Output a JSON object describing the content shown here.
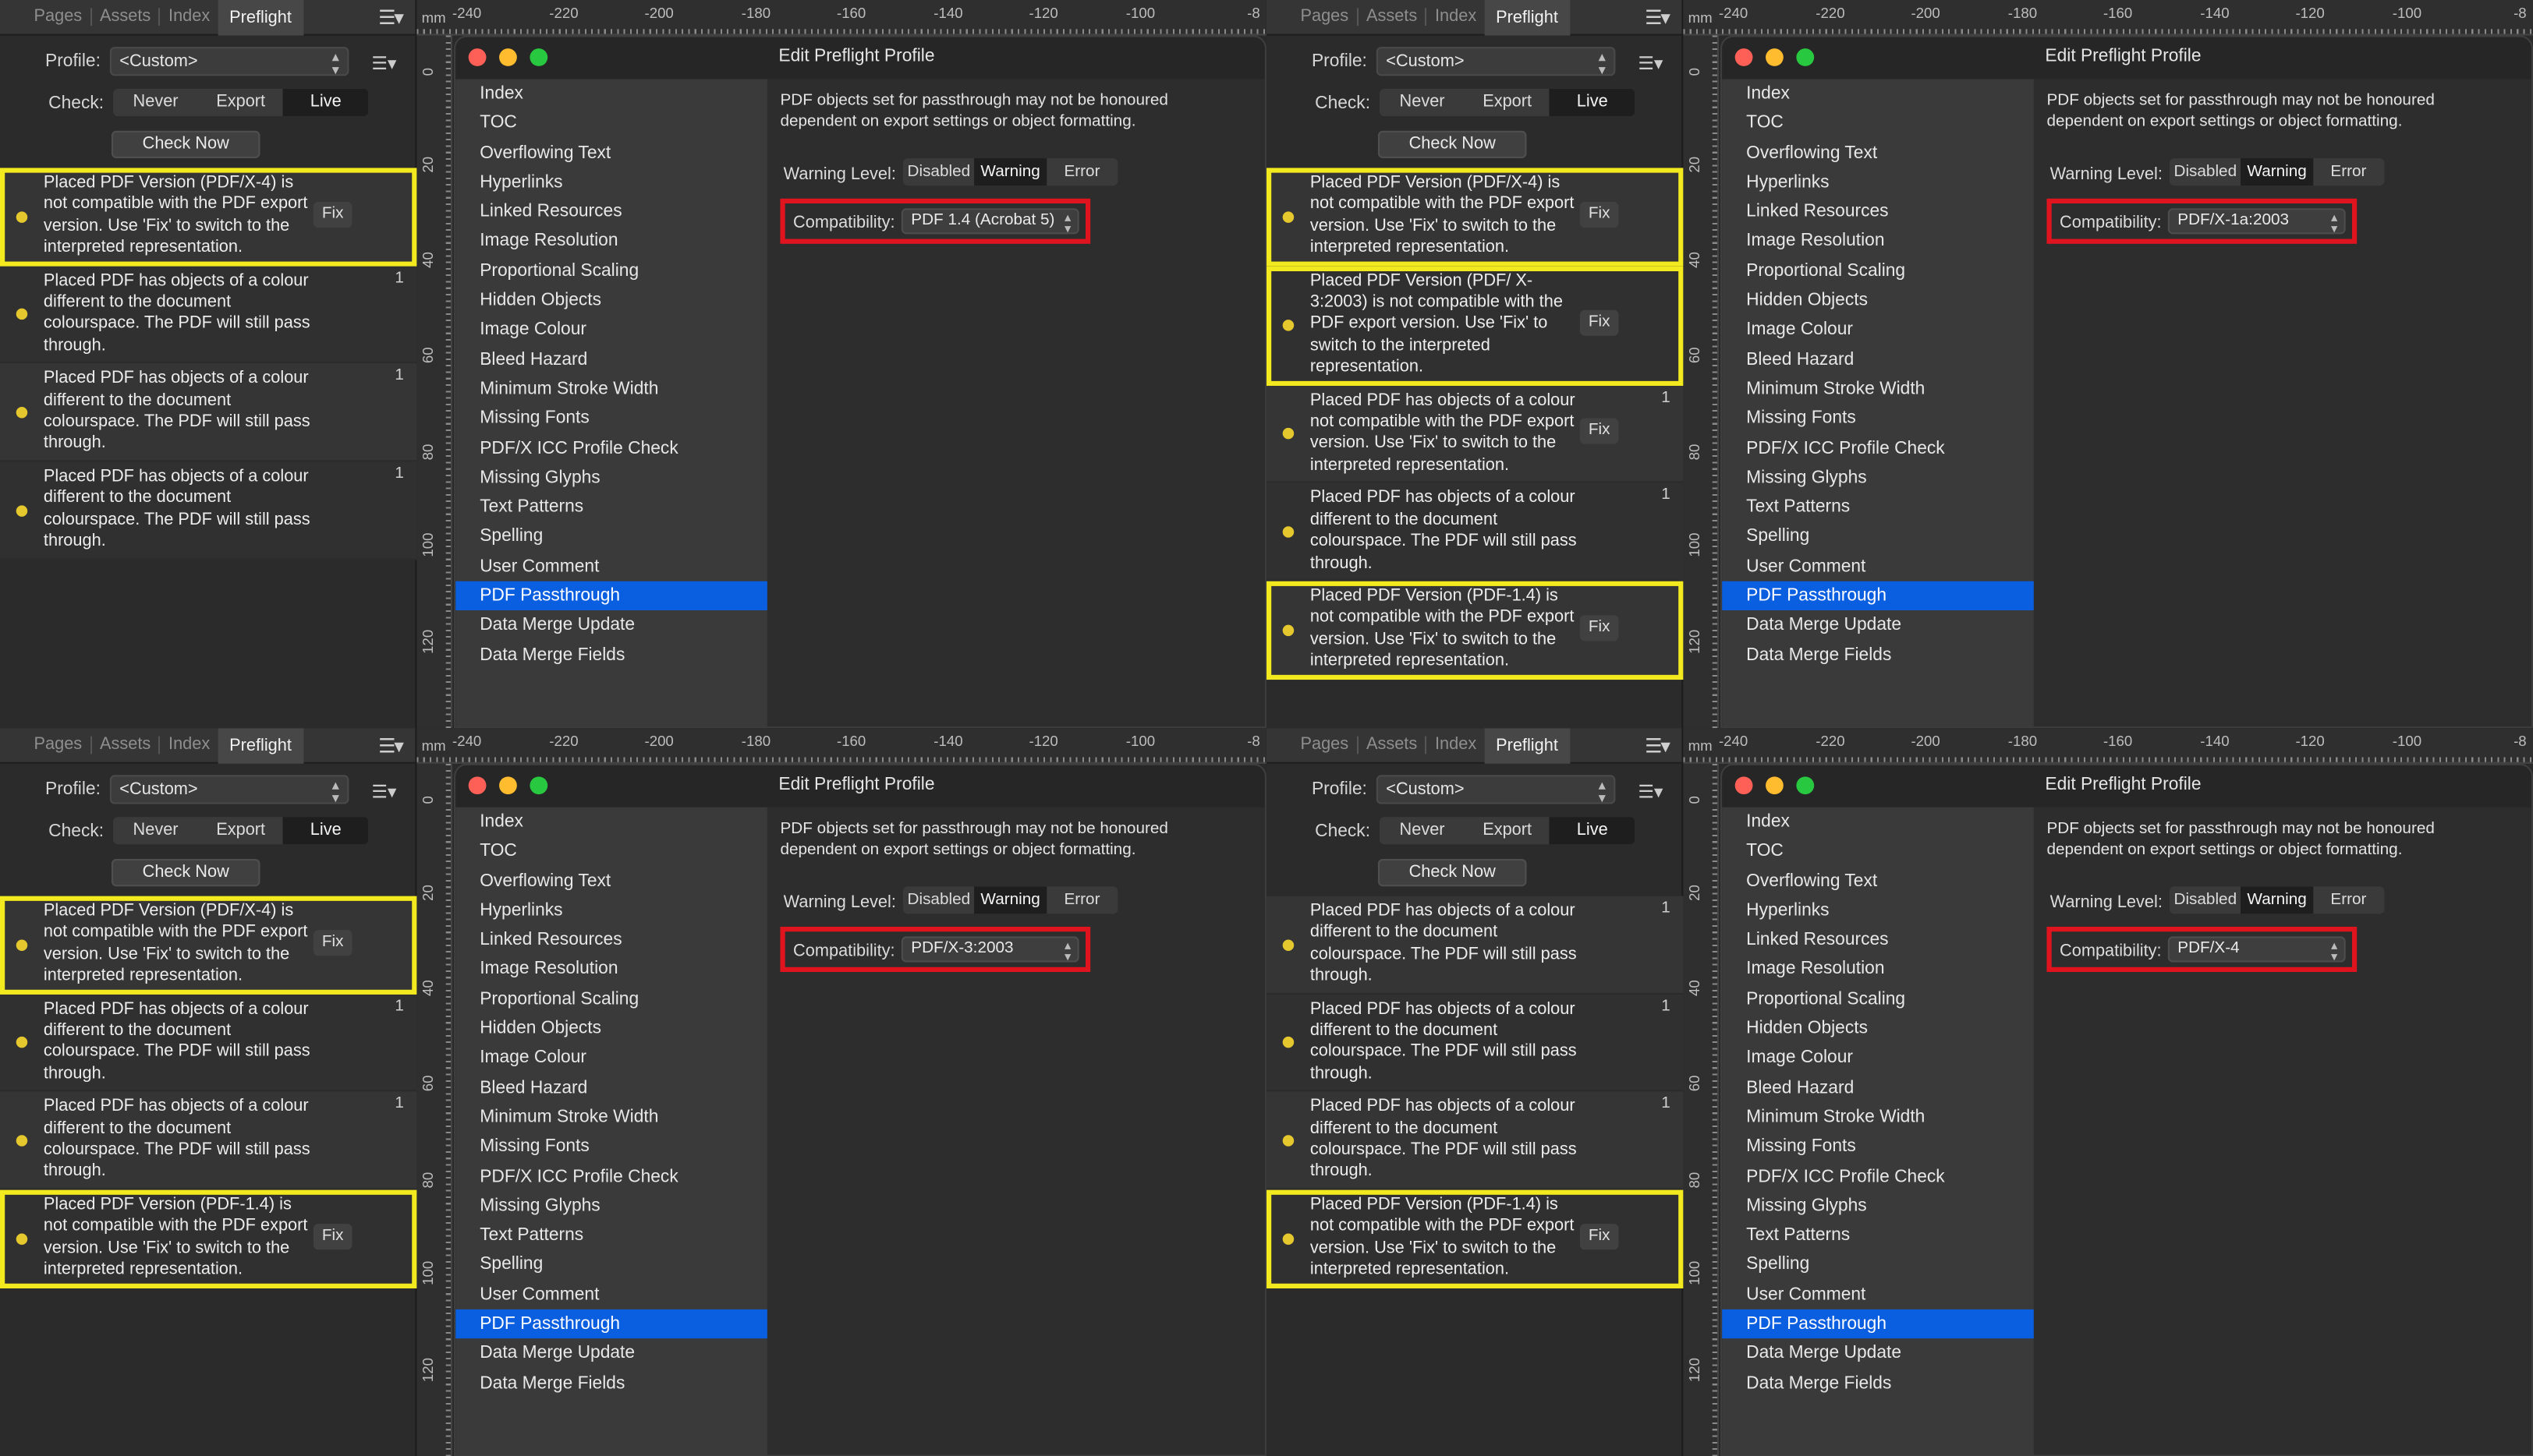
{
  "common": {
    "tabs": [
      "Pages",
      "Assets",
      "Index",
      "Preflight"
    ],
    "panel_menu_icon": "hamburger-menu-icon",
    "profile_label": "Profile:",
    "profile_value": "<Custom>",
    "check_label": "Check:",
    "check_options": [
      "Never",
      "Export",
      "Live"
    ],
    "check_now": "Check Now",
    "fix_label": "Fix",
    "ruler_unit": "mm",
    "ruler_top_ticks": [
      "-240",
      "-220",
      "-200",
      "-180",
      "-160",
      "-140",
      "-120",
      "-100",
      "-8"
    ],
    "ruler_left_ticks": [
      "0",
      "20",
      "40",
      "60",
      "80",
      "100",
      "120"
    ],
    "dialog_title": "Edit Preflight Profile",
    "dialog_items": [
      "Index",
      "TOC",
      "Overflowing Text",
      "Hyperlinks",
      "Linked Resources",
      "Image Resolution",
      "Proportional Scaling",
      "Hidden Objects",
      "Image Colour",
      "Bleed Hazard",
      "Minimum Stroke Width",
      "Missing Fonts",
      "PDF/X ICC Profile Check",
      "Missing Glyphs",
      "Text Patterns",
      "Spelling",
      "User Comment",
      "PDF Passthrough",
      "Data Merge Update",
      "Data Merge Fields"
    ],
    "selected_item": "PDF Passthrough",
    "description": "PDF objects set for passthrough may not be honoured dependent on export settings or object formatting.",
    "warning_level_label": "Warning Level:",
    "warning_levels": [
      "Disabled",
      "Warning",
      "Error"
    ],
    "warning_level_selected": "Warning",
    "compatibility_label": "Compatibility:",
    "highlight_color": "#f2ea1f",
    "compat_highlight_color": "#e0141f",
    "selection_color": "#0a5ee0"
  },
  "quadrants": [
    {
      "compatibility": "PDF 1.4 (Acrobat 5)",
      "issues": [
        {
          "text": "Placed PDF Version (PDF/X-4) is not compatible with the PDF export version. Use 'Fix' to switch to the interpreted representation.",
          "fix": true,
          "count": "",
          "highlight": true
        },
        {
          "text": "Placed PDF has objects of a colour different to the document colourspace. The PDF will still pass through.",
          "fix": false,
          "count": "1",
          "highlight": false
        },
        {
          "text": "Placed PDF has objects of a colour different to the document colourspace. The PDF will still pass through.",
          "fix": false,
          "count": "1",
          "highlight": false
        },
        {
          "text": "Placed PDF has objects of a colour different to the document colourspace. The PDF will still pass through.",
          "fix": false,
          "count": "1",
          "highlight": false
        }
      ]
    },
    {
      "compatibility": "PDF/X-1a:2003",
      "issues": [
        {
          "text": "Placed PDF Version (PDF/X-4) is not compatible with the PDF export version. Use 'Fix' to switch to the interpreted representation.",
          "fix": true,
          "count": "",
          "highlight": true
        },
        {
          "text": "Placed PDF Version (PDF/ X-3:2003) is not compatible with the PDF export version. Use 'Fix' to switch to the interpreted representation.",
          "fix": true,
          "count": "",
          "highlight": true
        },
        {
          "text": "Placed PDF has objects of a colour not compatible with the PDF export version. Use 'Fix' to switch to the interpreted representation.",
          "fix": true,
          "count": "1",
          "highlight": false
        },
        {
          "text": "Placed PDF has objects of a colour different to the document colourspace. The PDF will still pass through.",
          "fix": false,
          "count": "1",
          "highlight": false
        },
        {
          "text": "Placed PDF Version (PDF-1.4) is not compatible with the PDF export version. Use 'Fix' to switch to the interpreted representation.",
          "fix": true,
          "count": "",
          "highlight": true
        }
      ]
    },
    {
      "compatibility": "PDF/X-3:2003",
      "issues": [
        {
          "text": "Placed PDF Version (PDF/X-4) is not compatible with the PDF export version. Use 'Fix' to switch to the interpreted representation.",
          "fix": true,
          "count": "",
          "highlight": true
        },
        {
          "text": "Placed PDF has objects of a colour different to the document colourspace. The PDF will still pass through.",
          "fix": false,
          "count": "1",
          "highlight": false
        },
        {
          "text": "Placed PDF has objects of a colour different to the document colourspace. The PDF will still pass through.",
          "fix": false,
          "count": "1",
          "highlight": false
        },
        {
          "text": "Placed PDF Version (PDF-1.4) is not compatible with the PDF export version. Use 'Fix' to switch to the interpreted representation.",
          "fix": true,
          "count": "",
          "highlight": true
        }
      ]
    },
    {
      "compatibility": "PDF/X-4",
      "issues": [
        {
          "text": "Placed PDF has objects of a colour different to the document colourspace. The PDF will still pass through.",
          "fix": false,
          "count": "1",
          "highlight": false
        },
        {
          "text": "Placed PDF has objects of a colour different to the document colourspace. The PDF will still pass through.",
          "fix": false,
          "count": "1",
          "highlight": false
        },
        {
          "text": "Placed PDF has objects of a colour different to the document colourspace. The PDF will still pass through.",
          "fix": false,
          "count": "1",
          "highlight": false
        },
        {
          "text": "Placed PDF Version (PDF-1.4) is not compatible with the PDF export version. Use 'Fix' to switch to the interpreted representation.",
          "fix": true,
          "count": "",
          "highlight": true
        }
      ]
    }
  ]
}
